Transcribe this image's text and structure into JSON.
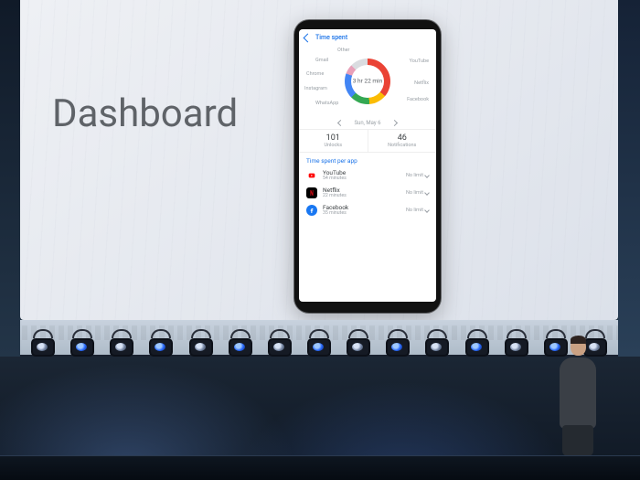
{
  "slide": {
    "title": "Dashboard"
  },
  "phone": {
    "appbar_title": "Time spent",
    "donut_center": "3 hr 22 min",
    "segments": {
      "youtube": "YouTube",
      "netflix": "Netflix",
      "facebook": "Facebook",
      "whatsapp": "WhatsApp",
      "instagram": "Instagram",
      "chrome": "Chrome",
      "gmail": "Gmail",
      "other": "Other"
    },
    "date_label": "Sun, May 6",
    "chevron_label": "›",
    "stats": {
      "unlocks_value": "101",
      "unlocks_label": "Unlocks",
      "notifications_value": "46",
      "notifications_label": "Notifications"
    },
    "section_header": "Time spent per app",
    "apps": [
      {
        "name": "YouTube",
        "subtitle": "54 minutes",
        "limit": "No limit"
      },
      {
        "name": "Netflix",
        "subtitle": "22 minutes",
        "limit": "No limit"
      },
      {
        "name": "Facebook",
        "subtitle": "35 minutes",
        "limit": "No limit"
      }
    ]
  }
}
